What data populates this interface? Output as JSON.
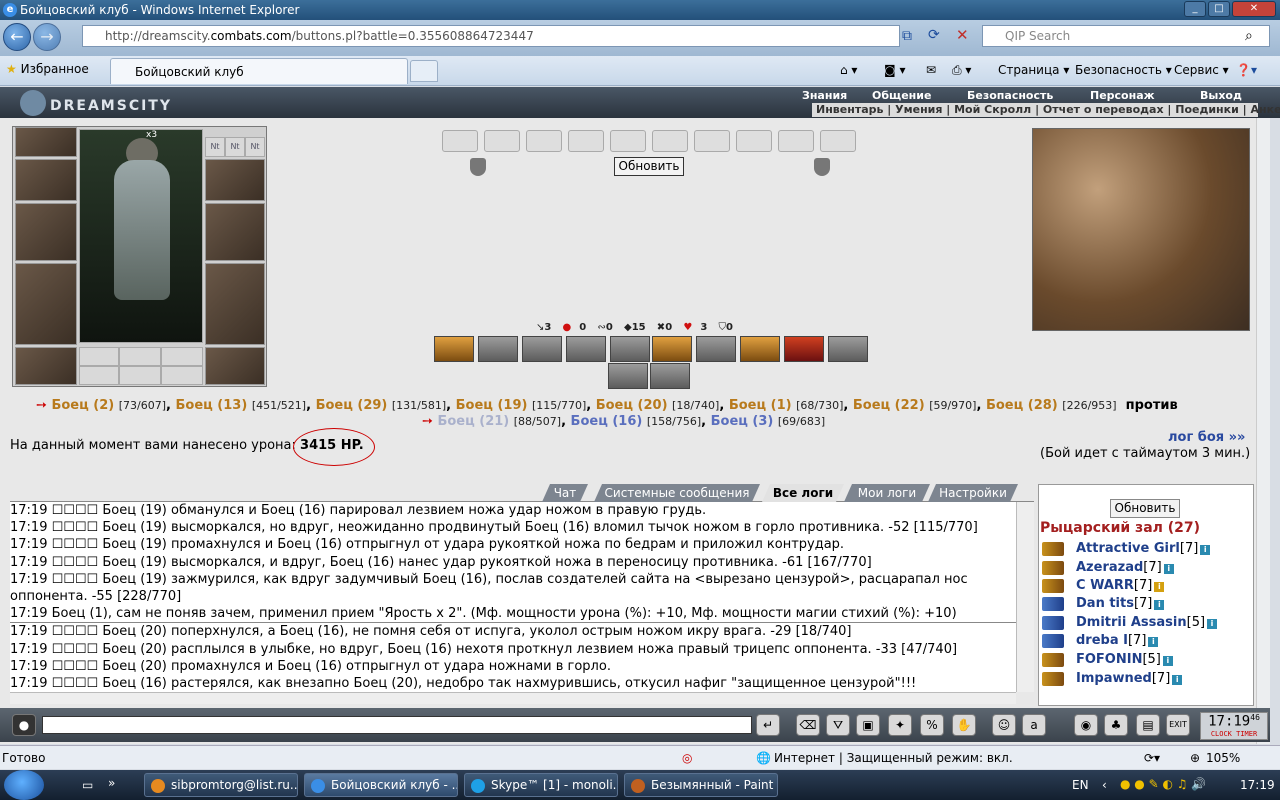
{
  "window": {
    "title": "Бойцовский клуб - Windows Internet Explorer"
  },
  "browser": {
    "url_prefix": "http://dreamscity.",
    "url_domain": "combats.com",
    "url_suffix": "/buttons.pl?battle=0.355608864723447",
    "search_placeholder": "QIP Search",
    "favorites_label": "Избранное",
    "tab_title": "Бойцовский клуб",
    "menu": [
      "Страница",
      "Безопасность",
      "Сервис"
    ]
  },
  "game": {
    "logo": "DREAMSCITY",
    "menu_top": [
      "Знания",
      "Общение",
      "Безопасность",
      "Персонаж",
      "Выход"
    ],
    "menu_sub": "Инвентарь | Умения | Мой Скролл | Отчет о переводах | Поединки | Анкета",
    "refresh": "Обновить",
    "ring_label": "Nt",
    "mult": "x3",
    "stats": [
      "3",
      "0",
      "0",
      "15",
      "0",
      "3",
      "0"
    ],
    "team1": [
      {
        "n": "Боец (2)",
        "hp": "[73/607]"
      },
      {
        "n": "Боец (13)",
        "hp": "[451/521]"
      },
      {
        "n": "Боец (29)",
        "hp": "[131/581]"
      },
      {
        "n": "Боец (19)",
        "hp": "[115/770]"
      },
      {
        "n": "Боец (20)",
        "hp": "[18/740]"
      },
      {
        "n": "Боец (1)",
        "hp": "[68/730]"
      },
      {
        "n": "Боец (22)",
        "hp": "[59/970]"
      },
      {
        "n": "Боец (28)",
        "hp": "[226/953]"
      }
    ],
    "vs": "против",
    "team2": [
      {
        "n": "Боец (21)",
        "hp": "[88/507]"
      },
      {
        "n": "Боец (16)",
        "hp": "[158/756]"
      },
      {
        "n": "Боец (3)",
        "hp": "[69/683]"
      }
    ],
    "damage_label": "На данный момент вами нанесено урона:",
    "damage_value": "3415 HP.",
    "log_link": "лог боя »»",
    "timeout": "(Бой идет с таймаутом 3 мин.)"
  },
  "logtabs": [
    "Чат",
    "Системные сообщения",
    "Все логи",
    "Мои логи",
    "Настройки"
  ],
  "log": [
    "17:19 ☐☐☐☐ Боец (19) обманулся и Боец (16) парировал лезвием ножа удар ножом в правую грудь.",
    "17:19 ☐☐☐☐ Боец (19) высморкался, но вдруг, неожиданно продвинутый Боец (16) вломил тычок ножом в горло противника. -52 [115/770]",
    "17:19 ☐☐☐☐ Боец (19) промахнулся и Боец (16) отпрыгнул от удара рукояткой ножа по бедрам и приложил контрудар.",
    "17:19 ☐☐☐☐ Боец (19) высморкался, и вдруг, Боец (16) нанес удар рукояткой ножа в переносицу противника. -61 [167/770]",
    "17:19 ☐☐☐☐ Боец (19) зажмурился, как вдруг задумчивый Боец (16), послав создателей сайта на <вырезано цензурой>, расцарапал нос оппонента. -55 [228/770]",
    "17:19 Боец (1), сам не поняв зачем, применил прием \"Ярость х 2\". (Мф. мощности урона (%): +10, Мф. мощности магии стихий (%): +10)",
    "17:19 ☐☐☐☐ Боец (20) поперхнулся, а Боец (16), не помня себя от испуга, уколол острым ножом икру врага. -29 [18/740]",
    "17:19 ☐☐☐☐ Боец (20) расплылся в улыбке, но вдруг, Боец (16) нехотя проткнул лезвием ножа правый трицепс оппонента. -33 [47/740]",
    "17:19 ☐☐☐☐ Боец (20) промахнулся и Боец (16) отпрыгнул от удара ножнами в горло.",
    "17:19 ☐☐☐☐ Боец (16) растерялся, как внезапно Боец (20), недобро так нахмурившись, откусил нафиг \"защищенное цензурой\"!!!"
  ],
  "hall": {
    "title": "Рыцарский зал (27)",
    "refresh": "Обновить",
    "users": [
      {
        "n": "Attractive Girl",
        "l": "[7]"
      },
      {
        "n": "Azerazad",
        "l": "[7]"
      },
      {
        "n": "C WARR",
        "l": "[7]"
      },
      {
        "n": "Dan tits",
        "l": "[7]"
      },
      {
        "n": "Dmitrii Assasin",
        "l": "[5]"
      },
      {
        "n": "dreba I",
        "l": "[7]"
      },
      {
        "n": "FOFONIN",
        "l": "[5]"
      },
      {
        "n": "Impawned",
        "l": "[7]"
      }
    ]
  },
  "clock": {
    "time": "17:19",
    "sec": "46",
    "clock": "CLOCK",
    "timer": "TIMER"
  },
  "status": {
    "ready": "Готово",
    "zone": "Интернет | Защищенный режим: вкл.",
    "zoom": "105%"
  },
  "taskbar": {
    "items": [
      "sibpromtorg@list.ru...",
      "Бойцовский клуб - ...",
      "Skype™ [1] - monoli...",
      "Безымянный - Paint"
    ],
    "lang": "EN",
    "time": "17:19"
  }
}
